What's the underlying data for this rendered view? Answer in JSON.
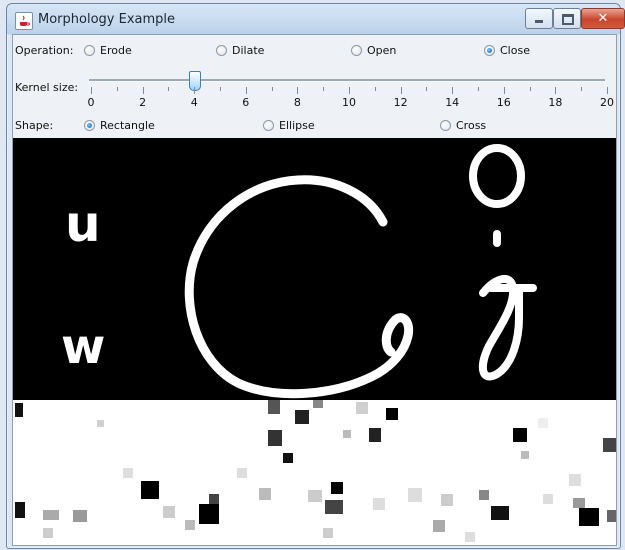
{
  "window": {
    "title": "Morphology Example"
  },
  "controls": {
    "operation_label": "Operation:",
    "operation_options": [
      {
        "label": "Erode",
        "selected": false
      },
      {
        "label": "Dilate",
        "selected": false
      },
      {
        "label": "Open",
        "selected": false
      },
      {
        "label": "Close",
        "selected": true
      }
    ],
    "kernel_label": "Kernel size:",
    "kernel_value": 4,
    "kernel_min": 0,
    "kernel_max": 20,
    "kernel_tick_labels": [
      "0",
      "2",
      "4",
      "6",
      "8",
      "10",
      "12",
      "14",
      "16",
      "18",
      "20"
    ],
    "shape_label": "Shape:",
    "shape_options": [
      {
        "label": "Rectangle",
        "selected": true
      },
      {
        "label": "Ellipse",
        "selected": false
      },
      {
        "label": "Cross",
        "selected": false
      }
    ]
  },
  "icons": {
    "app": "java-cup-icon",
    "minimize": "minimize-icon",
    "maximize": "maximize-icon",
    "close": "close-icon"
  },
  "image_text": {
    "letter_1": "u",
    "letter_2": "w"
  },
  "colors": {
    "close_button": "#c8452c",
    "selected_radio": "#1f5fa8",
    "slider_thumb": "#9fd4ff"
  }
}
